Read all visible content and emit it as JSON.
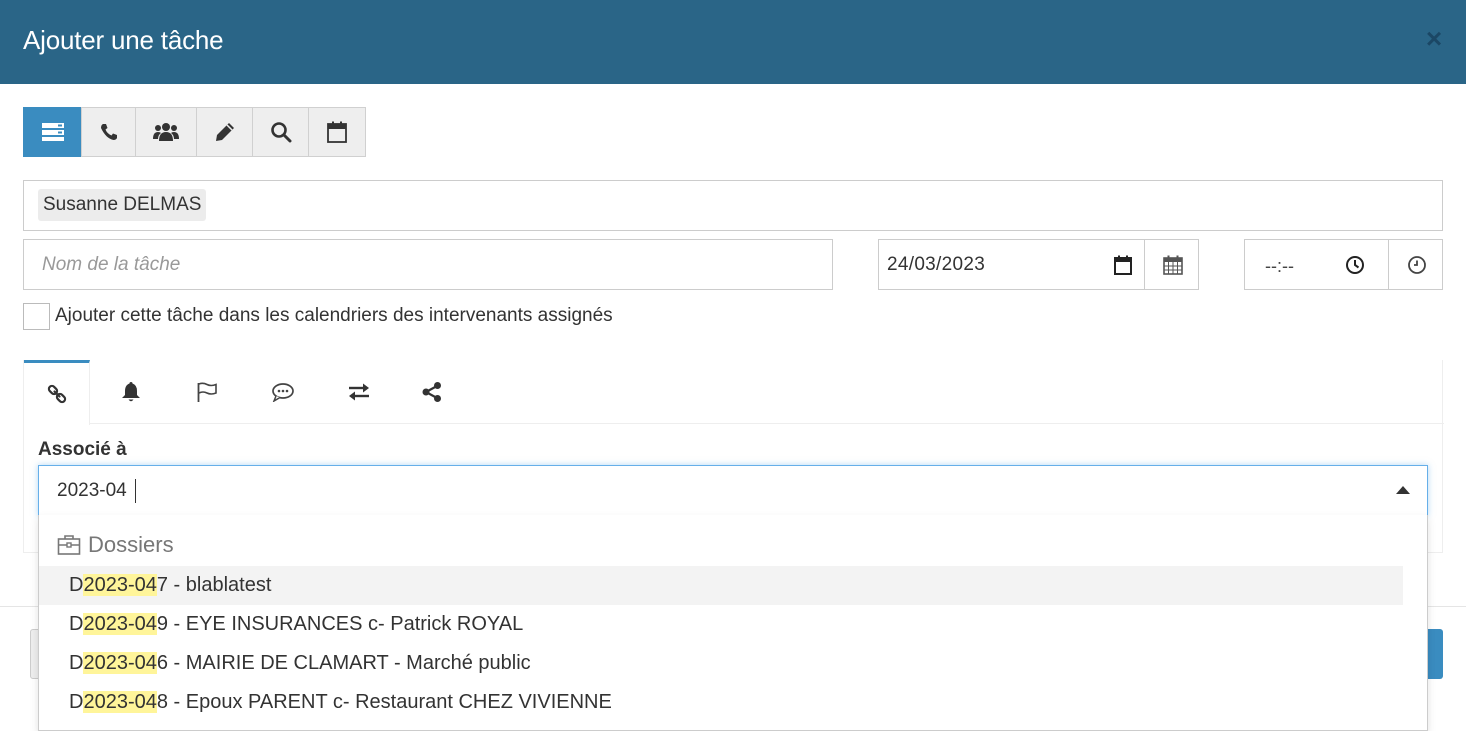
{
  "dialog": {
    "title": "Ajouter une tâche",
    "close_glyph": "×"
  },
  "type_buttons": [
    {
      "icon": "list-icon",
      "active": true
    },
    {
      "icon": "phone-icon",
      "active": false
    },
    {
      "icon": "group-icon",
      "active": false
    },
    {
      "icon": "pencil-icon",
      "active": false
    },
    {
      "icon": "search-icon",
      "active": false
    },
    {
      "icon": "calendar-icon",
      "active": false
    }
  ],
  "assignee": {
    "chip": "Susanne DELMAS"
  },
  "task_name": {
    "placeholder": "Nom de la tâche",
    "value": ""
  },
  "date": {
    "value": "24/03/2023"
  },
  "time": {
    "value": "--:--"
  },
  "calendar_option": {
    "label": "Ajouter cette tâche dans les calendriers des intervenants assignés",
    "checked": false
  },
  "tabs": [
    {
      "icon": "link-icon",
      "active": true
    },
    {
      "icon": "bell-icon",
      "active": false
    },
    {
      "icon": "flag-icon",
      "active": false
    },
    {
      "icon": "comment-icon",
      "active": false
    },
    {
      "icon": "exchange-icon",
      "active": false
    },
    {
      "icon": "share-icon",
      "active": false
    }
  ],
  "association": {
    "label": "Associé à",
    "value": "2023-04"
  },
  "dropdown": {
    "group_label": "Dossiers",
    "items": [
      {
        "prefix": "D",
        "match": "2023-04",
        "rest": "7 - blablatest",
        "highlighted": true
      },
      {
        "prefix": "D",
        "match": "2023-04",
        "rest": "9 - EYE INSURANCES c- Patrick ROYAL",
        "highlighted": false
      },
      {
        "prefix": "D",
        "match": "2023-04",
        "rest": "6 - MAIRIE DE CLAMART - Marché public",
        "highlighted": false
      },
      {
        "prefix": "D",
        "match": "2023-04",
        "rest": "8 - Epoux PARENT c- Restaurant CHEZ VIVIENNE",
        "highlighted": false
      }
    ]
  },
  "colors": {
    "header": "#2a6587",
    "accent": "#3a8cc0",
    "match_highlight": "#fff59a"
  }
}
